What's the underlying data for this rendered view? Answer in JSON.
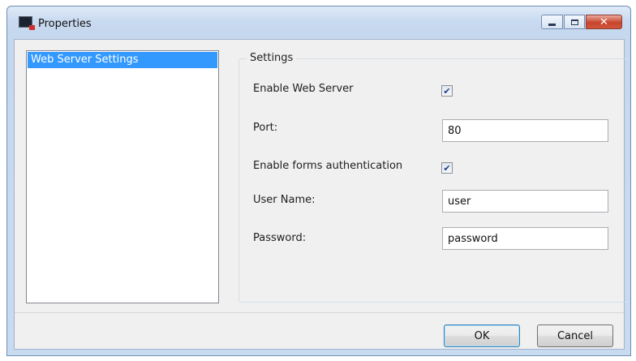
{
  "window": {
    "title": "Properties",
    "icon": "app-window-icon",
    "controls": {
      "minimize_icon": "minimize-icon",
      "maximize_icon": "maximize-icon",
      "close_glyph": "✕"
    }
  },
  "sidebar": {
    "items": [
      {
        "label": "Web Server Settings",
        "selected": true
      }
    ]
  },
  "settings": {
    "group_title": "Settings",
    "enable_web_server": {
      "label": "Enable Web Server",
      "checked": true,
      "mark": "✔"
    },
    "port": {
      "label": "Port:",
      "value": "80"
    },
    "enable_forms_auth": {
      "label": "Enable forms authentication",
      "checked": true,
      "mark": "✔"
    },
    "user_name": {
      "label": "User Name:",
      "value": "user"
    },
    "password": {
      "label": "Password:",
      "value": "password"
    }
  },
  "buttons": {
    "ok": "OK",
    "cancel": "Cancel"
  },
  "colors": {
    "selection": "#3399ff",
    "dialog_bg": "#f0f0f0",
    "close_button": "#c8452e"
  }
}
